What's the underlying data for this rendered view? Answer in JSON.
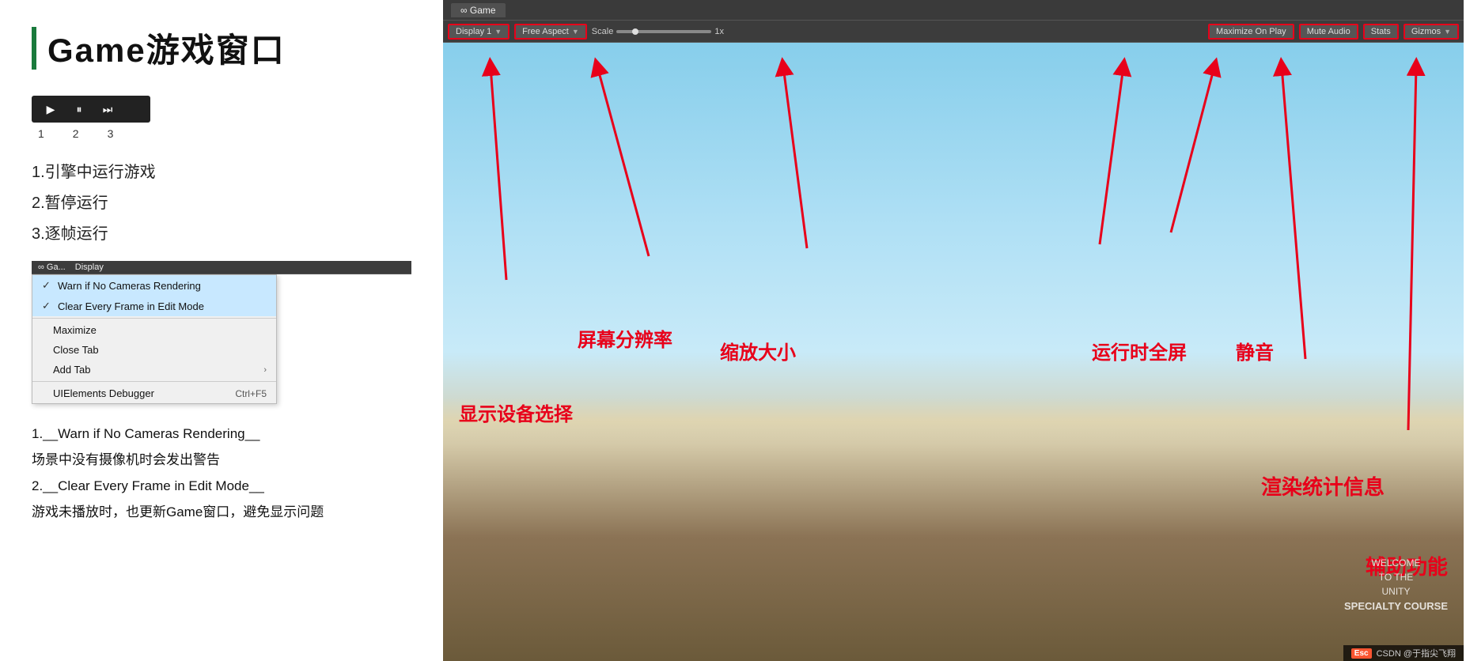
{
  "page": {
    "title": "Game游戏窗口"
  },
  "left": {
    "title": "Game游戏窗口",
    "playback": {
      "buttons": [
        "▶",
        "⏸",
        "⏭"
      ],
      "numbers": [
        "1",
        "2",
        "3"
      ]
    },
    "desc_items": [
      "1.引擎中运行游戏",
      "2.暂停运行",
      "3.逐帧运行"
    ],
    "context_menu": {
      "mini_bar": [
        "∞ Ga...",
        "Display"
      ],
      "items": [
        {
          "type": "checked",
          "label": "Warn if No Cameras Rendering",
          "highlighted": true
        },
        {
          "type": "checked",
          "label": "Clear Every Frame in Edit Mode",
          "highlighted": true
        },
        {
          "type": "normal",
          "label": "Maximize",
          "highlighted": false
        },
        {
          "type": "normal",
          "label": "Close Tab",
          "highlighted": false
        },
        {
          "type": "arrow",
          "label": "Add Tab",
          "highlighted": false
        },
        {
          "type": "shortcut",
          "label": "UIElements Debugger",
          "shortcut": "Ctrl+F5",
          "highlighted": false
        }
      ]
    },
    "bottom_desc": [
      "1.__Warn if No Cameras Rendering__",
      "场景中没有摄像机时会发出警告",
      "2.__Clear Every Frame in Edit Mode__",
      "游戏未播放时，也更新Game窗口，避免显示问题"
    ]
  },
  "right": {
    "game_tab": "∞ Game",
    "toolbar": {
      "display_btn": "Display 1",
      "aspect_btn": "Free Aspect",
      "scale_label": "Scale",
      "scale_value": "1x",
      "maximize_btn": "Maximize On Play",
      "mute_btn": "Mute Audio",
      "stats_btn": "Stats",
      "gizmos_btn": "Gizmos"
    },
    "annotations": {
      "display": "显示设备选择",
      "resolution": "屏幕分辨率",
      "scale": "缩放大小",
      "maximize": "运行时全屏",
      "mute": "静音",
      "stats": "渲染统计信息",
      "gizmos": "辅助功能"
    },
    "welcome": {
      "line1": "WELCOME",
      "line2": "TO THE",
      "line3": "UNITY",
      "line4": "SPECIALTY COURSE"
    },
    "csdn": {
      "logo": "Esc",
      "text": "CSDN @于指尖飞翔"
    }
  }
}
